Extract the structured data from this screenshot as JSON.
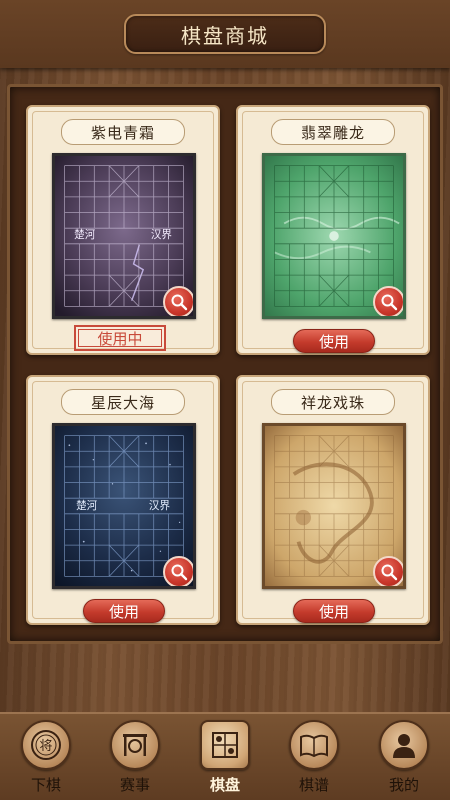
{
  "header": {
    "title": "棋盘商城"
  },
  "boards": [
    {
      "name": "紫电青霜",
      "action": "使用中",
      "state": "in-use",
      "theme": "purple",
      "river_left": "楚河",
      "river_right": "汉界"
    },
    {
      "name": "翡翠雕龙",
      "action": "使用",
      "state": "available",
      "theme": "jade",
      "river_left": "",
      "river_right": ""
    },
    {
      "name": "星辰大海",
      "action": "使用",
      "state": "available",
      "theme": "starry",
      "river_left": "楚河",
      "river_right": "汉界"
    },
    {
      "name": "祥龙戏珠",
      "action": "使用",
      "state": "available",
      "theme": "parchment",
      "river_left": "",
      "river_right": ""
    }
  ],
  "nav": [
    {
      "label": "下棋",
      "icon": "general-piece-icon"
    },
    {
      "label": "赛事",
      "icon": "gong-icon"
    },
    {
      "label": "棋盘",
      "icon": "board-icon",
      "active": true
    },
    {
      "label": "棋谱",
      "icon": "book-icon"
    },
    {
      "label": "我的",
      "icon": "user-icon"
    }
  ],
  "colors": {
    "accent_red": "#c43b2c",
    "card_bg": "#f5ead4",
    "wood": "#6b4529"
  }
}
